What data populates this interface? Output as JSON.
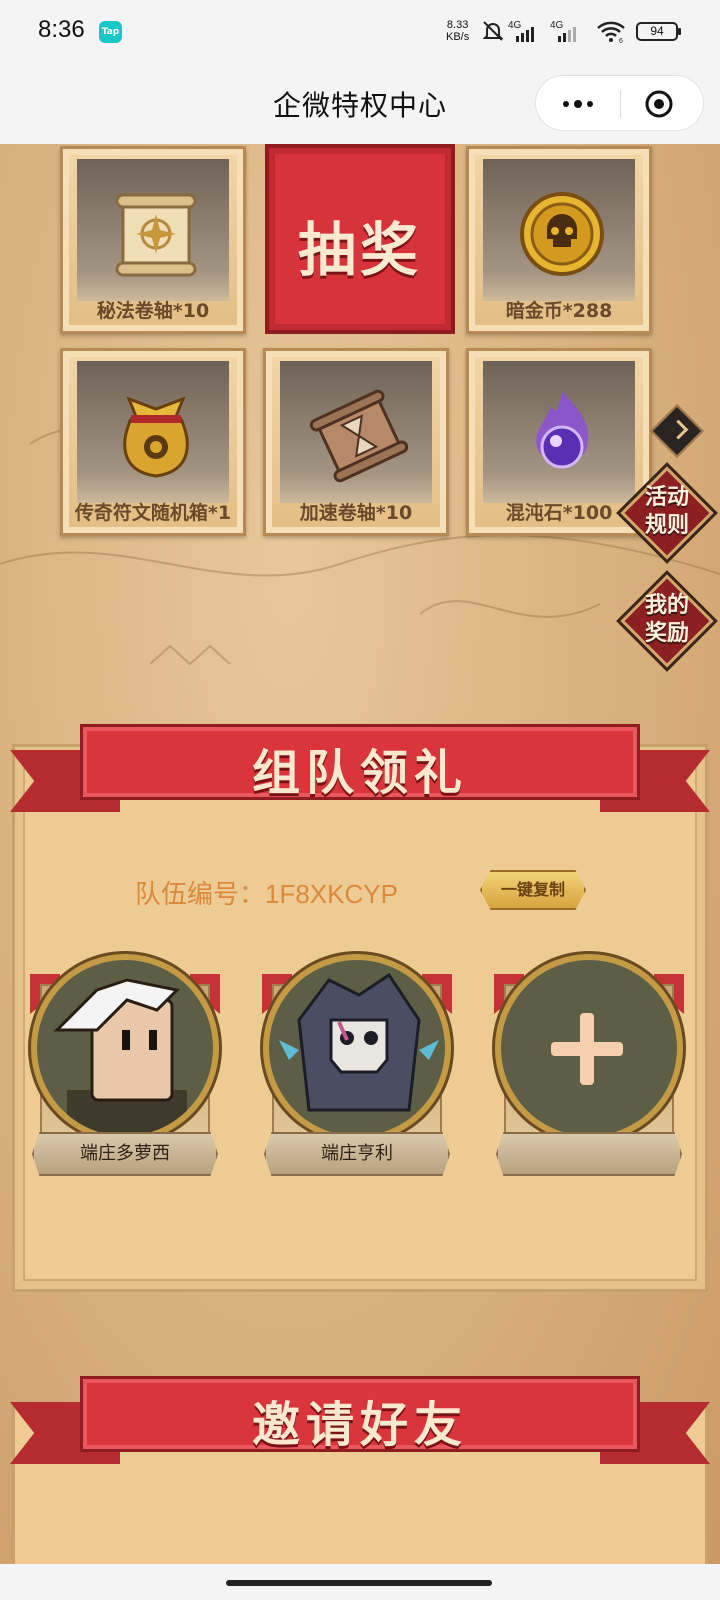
{
  "status_bar": {
    "time": "8:36",
    "app_badge": "Tap",
    "net_speed_value": "8.33",
    "net_speed_unit": "KB/s",
    "network_1": "4G",
    "network_2": "4G",
    "wifi_sub": "6",
    "battery": "94"
  },
  "title_bar": {
    "title": "企微特权中心"
  },
  "rewards": {
    "draw_label": "抽奖",
    "items": [
      {
        "label": "秘法卷轴*10",
        "icon": "scroll-icon"
      },
      {
        "label": "暗金币*288",
        "icon": "skull-coin-icon"
      },
      {
        "label": "传奇符文随机箱*1",
        "icon": "gold-bag-icon"
      },
      {
        "label": "加速卷轴*10",
        "icon": "hourglass-scroll-icon"
      },
      {
        "label": "混沌石*100",
        "icon": "chaos-stone-icon"
      }
    ]
  },
  "side_buttons": {
    "rules": "活动\n规则",
    "my_rewards": "我的\n奖励"
  },
  "team": {
    "heading": "组队领礼",
    "team_id_label": "队伍编号：1F8XKCYP",
    "copy_button": "一键复制",
    "members": [
      {
        "name": "端庄多萝西"
      },
      {
        "name": "端庄亨利"
      },
      {
        "name": ""
      }
    ]
  },
  "invite": {
    "heading": "邀请好友"
  },
  "colors": {
    "ribbon_red": "#d9353b",
    "parchment": "#edcb93",
    "gold": "#c49a45"
  }
}
